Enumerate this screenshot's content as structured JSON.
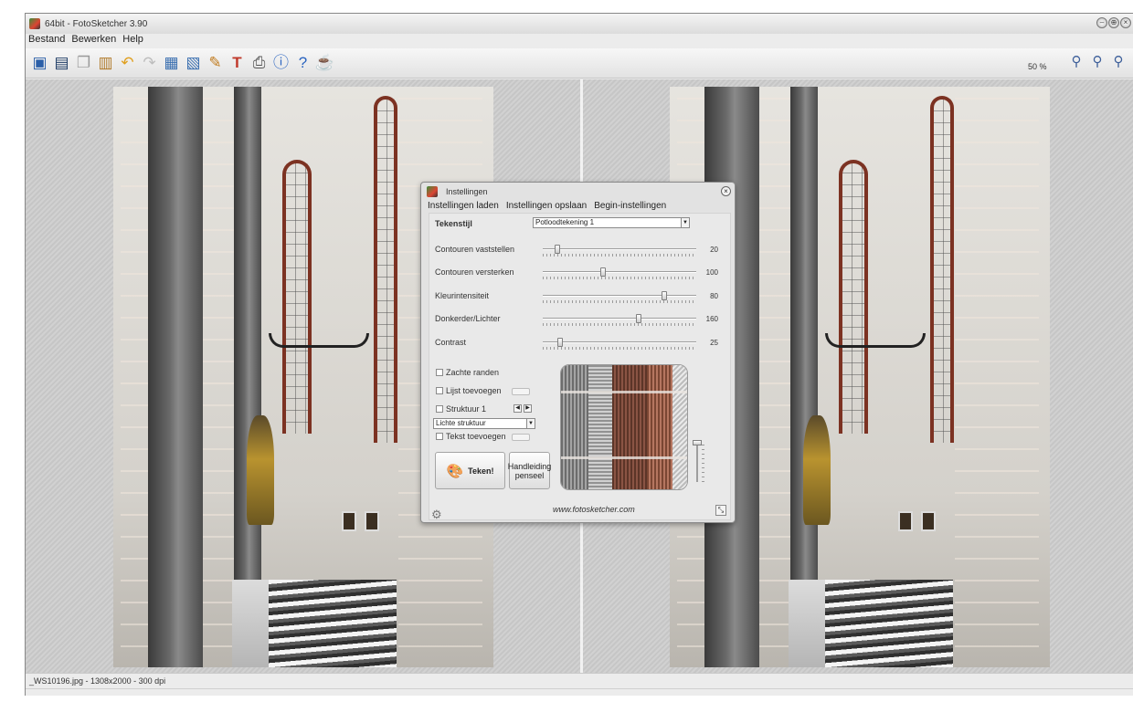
{
  "window": {
    "title": "64bit - FotoSketcher 3.90",
    "controls": [
      "–",
      "⊕",
      "×"
    ]
  },
  "menu": {
    "items": [
      "Bestand",
      "Bewerken",
      "Help"
    ]
  },
  "toolbar": {
    "zoom": "50 %"
  },
  "status": {
    "file_info": "_WS10196.jpg - 1308x2000 - 300 dpi"
  },
  "dialog": {
    "title": "Instellingen",
    "menu": [
      "Instellingen laden",
      "Instellingen opslaan",
      "Begin-instellingen"
    ],
    "style_label": "Tekenstijl",
    "style_value": "Potloodtekening 1",
    "sliders": [
      {
        "label": "Contouren vaststellen",
        "value": "20",
        "position": 0.08
      },
      {
        "label": "Contouren versterken",
        "value": "100",
        "position": 0.39
      },
      {
        "label": "Kleurintensiteit",
        "value": "80",
        "position": 0.8
      },
      {
        "label": "Donkerder/Lichter",
        "value": "160",
        "position": 0.63
      },
      {
        "label": "Contrast",
        "value": "25",
        "position": 0.1
      }
    ],
    "options": {
      "soft_edges": "Zachte randen",
      "add_frame": "Lijst toevoegen",
      "texture": "Struktuur 1",
      "texture_type": "Lichte struktuur",
      "add_text": "Tekst toevoegen"
    },
    "draw_button": "Teken!",
    "manual_button": "Handleiding penseel",
    "website": "www.fotosketcher.com"
  }
}
